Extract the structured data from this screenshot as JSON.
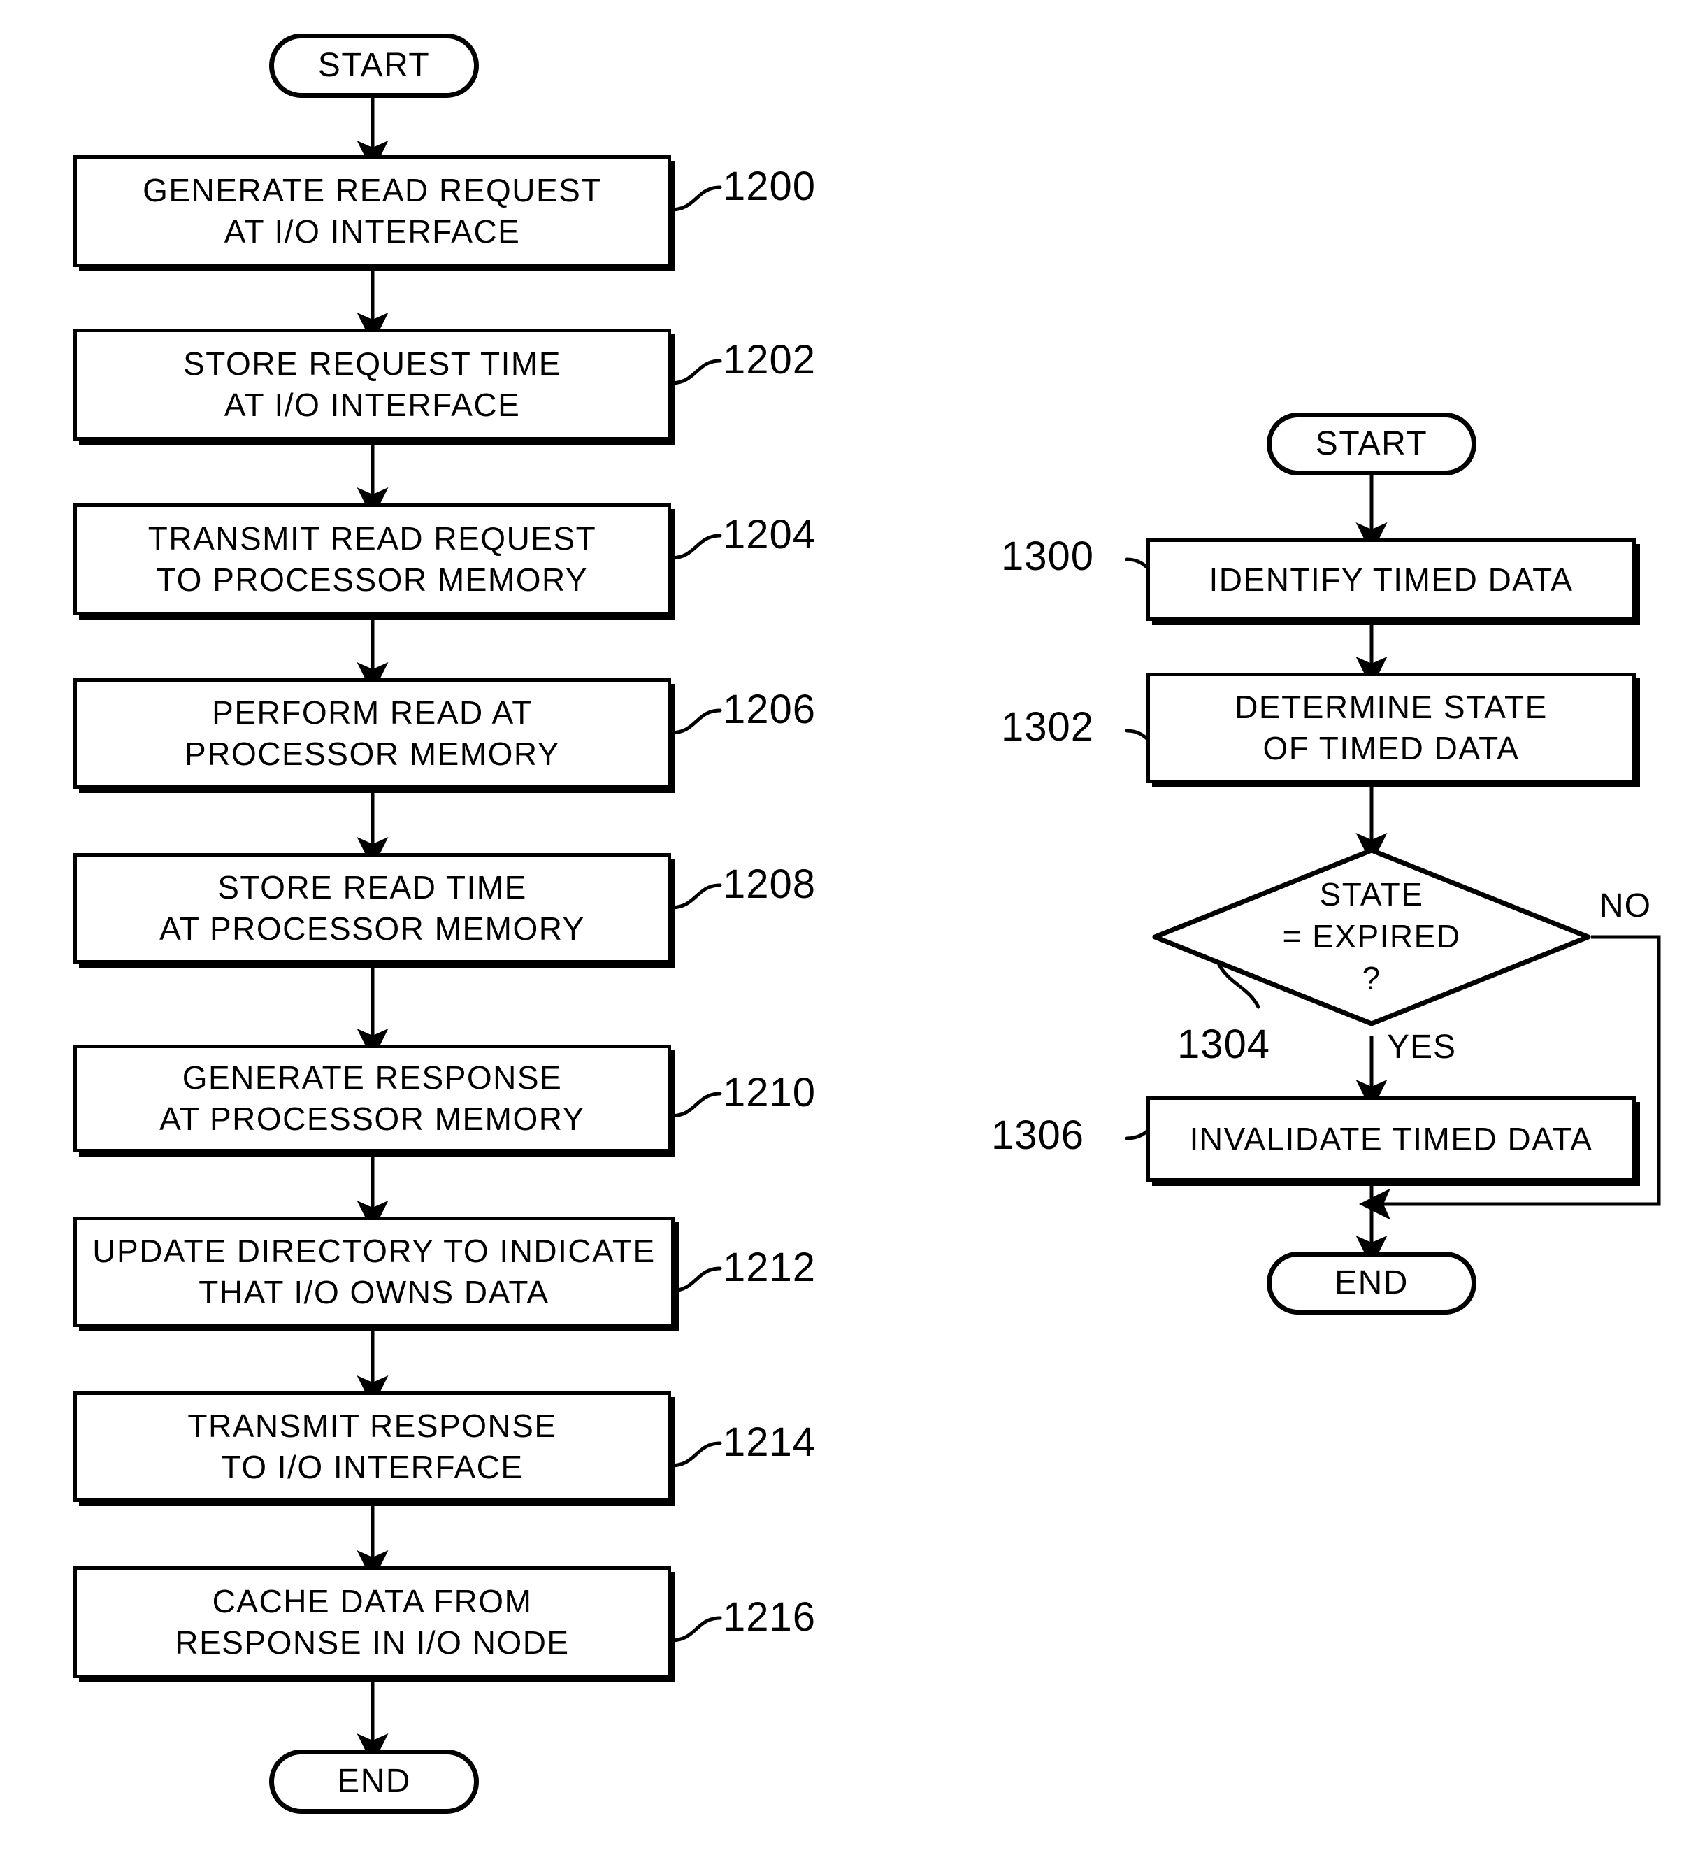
{
  "figures": [
    {
      "id": "figure-12",
      "nodes": [
        {
          "kind": "terminator",
          "label": "START"
        },
        {
          "kind": "process",
          "ref": "1200",
          "lines": [
            "GENERATE READ REQUEST",
            "AT I/O INTERFACE"
          ]
        },
        {
          "kind": "process",
          "ref": "1202",
          "lines": [
            "STORE REQUEST TIME",
            "AT I/O INTERFACE"
          ]
        },
        {
          "kind": "process",
          "ref": "1204",
          "lines": [
            "TRANSMIT READ REQUEST",
            "TO PROCESSOR MEMORY"
          ]
        },
        {
          "kind": "process",
          "ref": "1206",
          "lines": [
            "PERFORM READ AT",
            "PROCESSOR MEMORY"
          ]
        },
        {
          "kind": "process",
          "ref": "1208",
          "lines": [
            "STORE READ TIME",
            "AT PROCESSOR MEMORY"
          ]
        },
        {
          "kind": "process",
          "ref": "1210",
          "lines": [
            "GENERATE RESPONSE",
            "AT PROCESSOR MEMORY"
          ]
        },
        {
          "kind": "process",
          "ref": "1212",
          "lines": [
            "UPDATE DIRECTORY TO INDICATE",
            "THAT I/O OWNS DATA"
          ]
        },
        {
          "kind": "process",
          "ref": "1214",
          "lines": [
            "TRANSMIT RESPONSE",
            "TO I/O INTERFACE"
          ]
        },
        {
          "kind": "process",
          "ref": "1216",
          "lines": [
            "CACHE DATA FROM",
            "RESPONSE IN I/O NODE"
          ]
        },
        {
          "kind": "terminator",
          "label": "END"
        }
      ]
    },
    {
      "id": "figure-13",
      "nodes": [
        {
          "kind": "terminator",
          "label": "START"
        },
        {
          "kind": "process",
          "ref": "1300",
          "lines": [
            "IDENTIFY TIMED DATA"
          ]
        },
        {
          "kind": "process",
          "ref": "1302",
          "lines": [
            "DETERMINE STATE",
            "OF TIMED DATA"
          ]
        },
        {
          "kind": "decision",
          "ref": "1304",
          "lines": [
            "STATE",
            "= EXPIRED",
            "?"
          ],
          "branches": [
            "NO",
            "YES"
          ]
        },
        {
          "kind": "process",
          "ref": "1306",
          "lines": [
            "INVALIDATE TIMED DATA"
          ]
        },
        {
          "kind": "terminator",
          "label": "END"
        }
      ]
    }
  ],
  "left": {
    "start_label": "START",
    "end_label": "END",
    "b1200": {
      "l1": "GENERATE READ REQUEST",
      "l2": "AT I/O INTERFACE",
      "ref": "1200"
    },
    "b1202": {
      "l1": "STORE REQUEST TIME",
      "l2": "AT I/O INTERFACE",
      "ref": "1202"
    },
    "b1204": {
      "l1": "TRANSMIT READ REQUEST",
      "l2": "TO PROCESSOR MEMORY",
      "ref": "1204"
    },
    "b1206": {
      "l1": "PERFORM READ AT",
      "l2": "PROCESSOR MEMORY",
      "ref": "1206"
    },
    "b1208": {
      "l1": "STORE READ TIME",
      "l2": "AT PROCESSOR MEMORY",
      "ref": "1208"
    },
    "b1210": {
      "l1": "GENERATE RESPONSE",
      "l2": "AT PROCESSOR MEMORY",
      "ref": "1210"
    },
    "b1212": {
      "l1": "UPDATE DIRECTORY TO INDICATE",
      "l2": "THAT I/O OWNS DATA",
      "ref": "1212"
    },
    "b1214": {
      "l1": "TRANSMIT RESPONSE",
      "l2": "TO I/O INTERFACE",
      "ref": "1214"
    },
    "b1216": {
      "l1": "CACHE DATA FROM",
      "l2": "RESPONSE IN I/O NODE",
      "ref": "1216"
    }
  },
  "right": {
    "start_label": "START",
    "end_label": "END",
    "b1300": {
      "l1": "IDENTIFY TIMED DATA",
      "ref": "1300"
    },
    "b1302": {
      "l1": "DETERMINE STATE",
      "l2": "OF TIMED DATA",
      "ref": "1302"
    },
    "d1304": {
      "l1": "STATE",
      "l2": "= EXPIRED",
      "l3": "?",
      "ref": "1304",
      "no_label": "NO",
      "yes_label": "YES"
    },
    "b1306": {
      "l1": "INVALIDATE TIMED DATA",
      "ref": "1306"
    }
  },
  "colors": {
    "ink": "#000000",
    "paper": "#ffffff"
  }
}
